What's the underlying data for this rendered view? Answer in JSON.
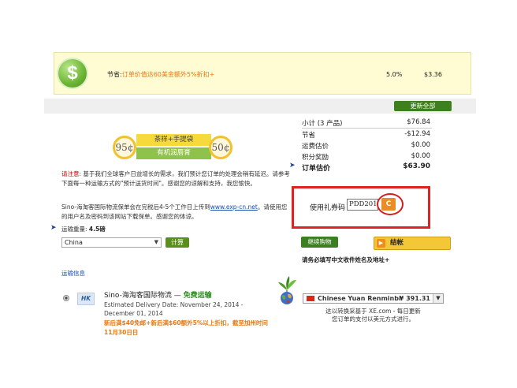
{
  "savings": {
    "icon": "dollar-icon",
    "icon_glyph": "$",
    "label": "节省:",
    "promo_text": "订单价值达60美金额外5%折扣+",
    "percent": "5.0%",
    "amount": "$3.36"
  },
  "update_all_label": "更新全部",
  "summary": {
    "rows": [
      {
        "label": "小计 (3 产品)",
        "value": "$76.84"
      },
      {
        "label": "节省",
        "value": "-$12.94"
      },
      {
        "label": "运费估价",
        "value": "$0.00"
      },
      {
        "label": "积分奖励",
        "value": "$0.00"
      }
    ],
    "total_label": "订单估价",
    "total_value": "$63.90"
  },
  "promo": {
    "left_price": "95¢",
    "right_price": "50¢",
    "top_label": "茶样+手提袋",
    "bottom_label": "有机润唇膏"
  },
  "note": {
    "prefix": "请注意",
    "text": ": 基于我们全球客户日益增长的需求，我们预计您订单的处理会稍有延迟。请参考下面每一种运输方式的\"预计送货时间\"。感谢您的谅解和支持，我您愉快。"
  },
  "shipping_note": {
    "text": "Sino-海淘客国际物流保单会在完税后4-5个工作日上传到",
    "link": "www.exp-cn.net",
    "text2": "。请使用您的用户名及密码到该网站下载保单。感谢您的体谅。"
  },
  "weight": {
    "label": "运输重量:",
    "value": "4.5磅"
  },
  "country": {
    "selected": "China",
    "caret": "▼",
    "calc_label": "计算"
  },
  "shipping_info_link": "运输信息",
  "carrier": {
    "logo_text": "HK",
    "name": "Sino-海淘客国际物流 — ",
    "free_label": "免费运输",
    "delivery": "Estimated Delivery Date: November 24, 2014 - December 01, 2014",
    "promo": "新后满$40免邮+新后满$60额外5%以上折扣，截至加州时间11月30日日"
  },
  "coupon": {
    "label": "使用礼券码",
    "value": "PDD201",
    "button_glyph": "C"
  },
  "actions": {
    "continue_label": "继续购物",
    "checkout_label": "结帐",
    "checkout_glyph": "▶",
    "name_notice": "请务必填写中文收件姓名及地址+"
  },
  "currency": {
    "name": "Chinese Yuan Renminbi",
    "amount": "¥ 391.31",
    "caret": "▼",
    "note": "这以转换采基于 XE.com - 每日更新\n您订单的支付以美元方式进行。"
  },
  "colors": {
    "accent_green": "#3e7f1e",
    "accent_orange": "#e87812",
    "alert_red": "#e02222",
    "link_blue": "#1a4fb1"
  }
}
